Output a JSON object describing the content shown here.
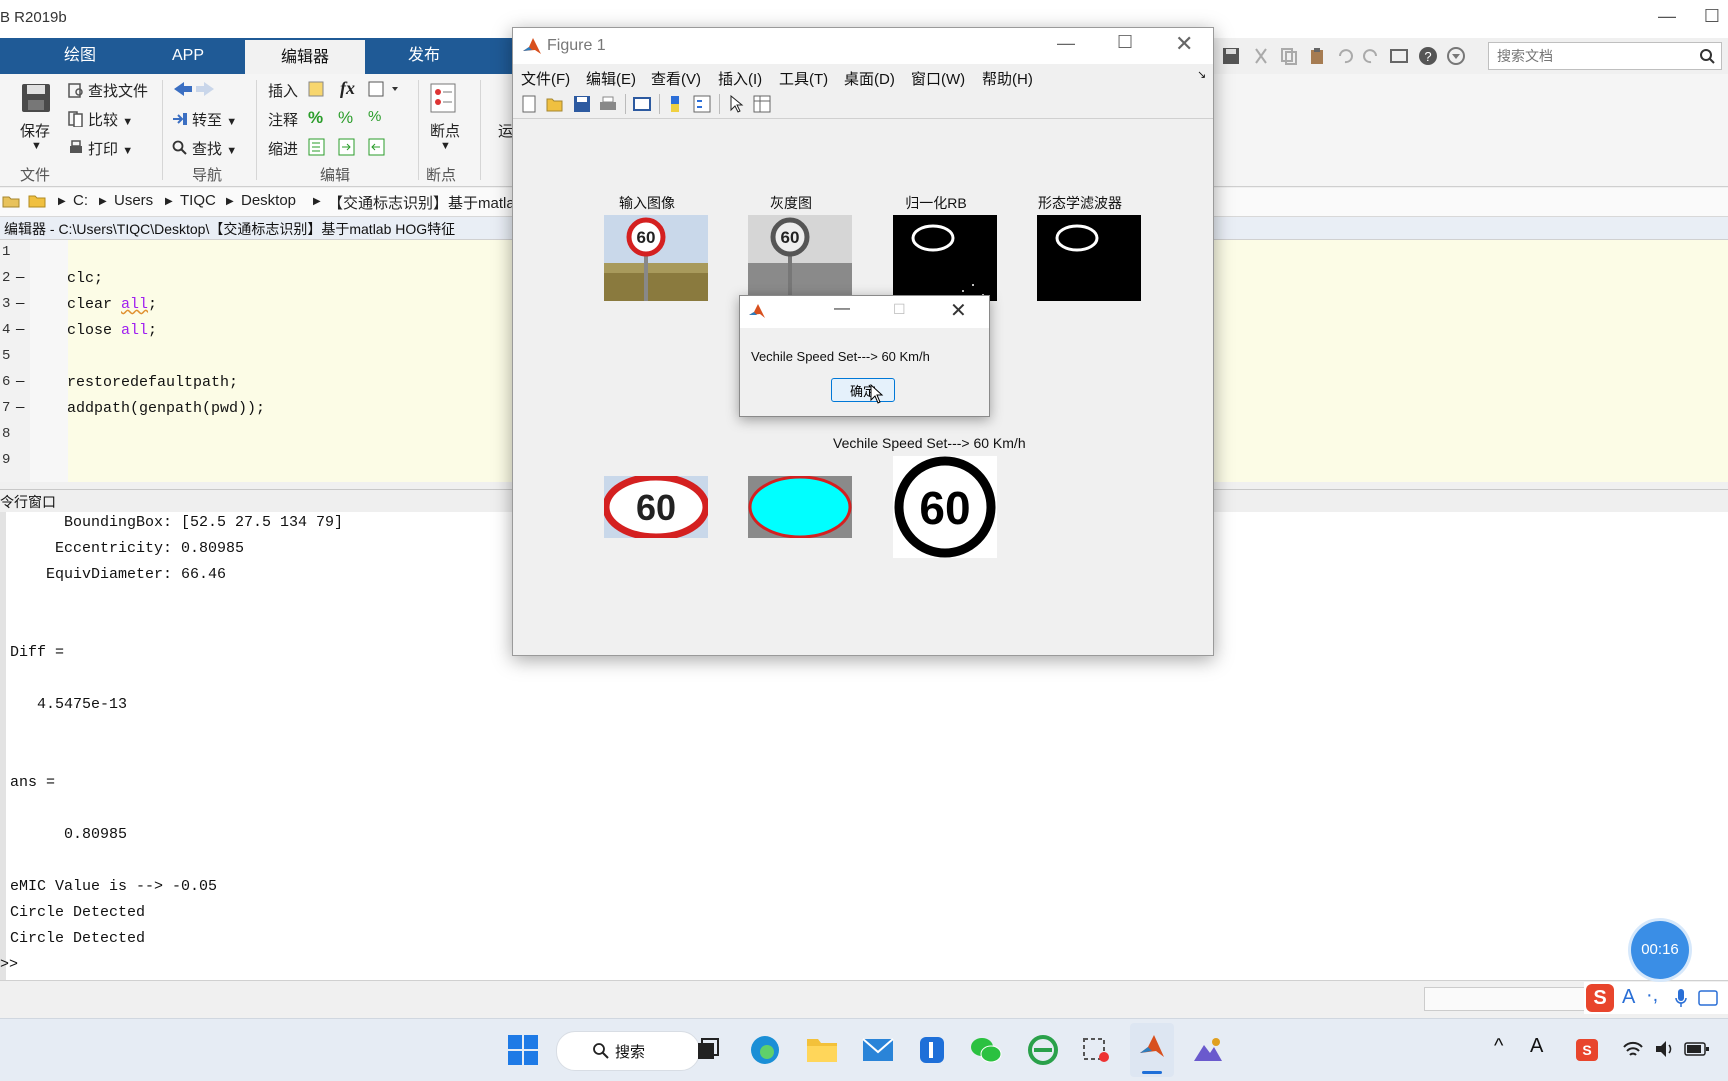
{
  "app": {
    "title_fragment": "B R2019b"
  },
  "tabs": [
    "绘图",
    "APP",
    "编辑器",
    "发布"
  ],
  "ribbon": {
    "file": {
      "save": "保存",
      "find_files": "查找文件",
      "compare": "比较",
      "print": "打印",
      "group": "文件"
    },
    "nav": {
      "goto": "转至",
      "find": "查找",
      "group": "导航"
    },
    "edit": {
      "insert": "插入",
      "comment": "注释",
      "indent": "缩进",
      "group": "编辑"
    },
    "breakpoints": {
      "label": "断点",
      "group": "断点"
    },
    "run_fragment": "运"
  },
  "search": {
    "placeholder": "搜索文档"
  },
  "address": {
    "segments": [
      "C:",
      "Users",
      "TIQC",
      "Desktop",
      "【交通标志识别】基于matla"
    ]
  },
  "editor": {
    "title": "编辑器 - C:\\Users\\TIQC\\Desktop\\【交通标志识别】基于matlab HOG特征",
    "lines": [
      {
        "n": "1",
        "dash": "",
        "code": ""
      },
      {
        "n": "2",
        "dash": "—",
        "code": "clc;"
      },
      {
        "n": "3",
        "dash": "—",
        "code_pre": "clear ",
        "code_kw": "all",
        "code_post": ";"
      },
      {
        "n": "4",
        "dash": "—",
        "code_pre": "close ",
        "code_kw": "all",
        "code_post": ";"
      },
      {
        "n": "5",
        "dash": "",
        "code": ""
      },
      {
        "n": "6",
        "dash": "—",
        "code": "restoredefaultpath;"
      },
      {
        "n": "7",
        "dash": "—",
        "code": "addpath(genpath(pwd));"
      },
      {
        "n": "8",
        "dash": "",
        "code": ""
      },
      {
        "n": "9",
        "dash": "",
        "code": ""
      }
    ]
  },
  "command_window": {
    "title": "令行窗口",
    "lines": [
      "      BoundingBox: [52.5 27.5 134 79]",
      "     Eccentricity: 0.80985",
      "    EquivDiameter: 66.46",
      "",
      "",
      "Diff =",
      "",
      "   4.5475e-13",
      "",
      "",
      "ans =",
      "",
      "      0.80985",
      "",
      "eMIC Value is --> -0.05",
      "Circle Detected",
      "Circle Detected"
    ],
    "prompt": ">>"
  },
  "figure": {
    "title": "Figure 1",
    "menu": [
      "文件(F)",
      "编辑(E)",
      "查看(V)",
      "插入(I)",
      "工具(T)",
      "桌面(D)",
      "窗口(W)",
      "帮助(H)"
    ],
    "axes_titles": [
      "输入图像",
      "灰度图",
      "归一化RB",
      "形态学滤波器"
    ],
    "result_title": "Vechile Speed Set---> 60 Km/h",
    "sign_text": "60"
  },
  "dialog": {
    "message": "Vechile Speed Set---> 60 Km/h",
    "ok_label": "确定"
  },
  "timer": "00:16",
  "taskbar": {
    "search_label": "搜索"
  },
  "colors": {
    "matlab_blue": "#1f5a96",
    "editor_bg": "#fcfce6",
    "cyan_ellipse": "#00ffff",
    "sign_red": "#d42020",
    "timer_blue": "#3a8ee6"
  }
}
